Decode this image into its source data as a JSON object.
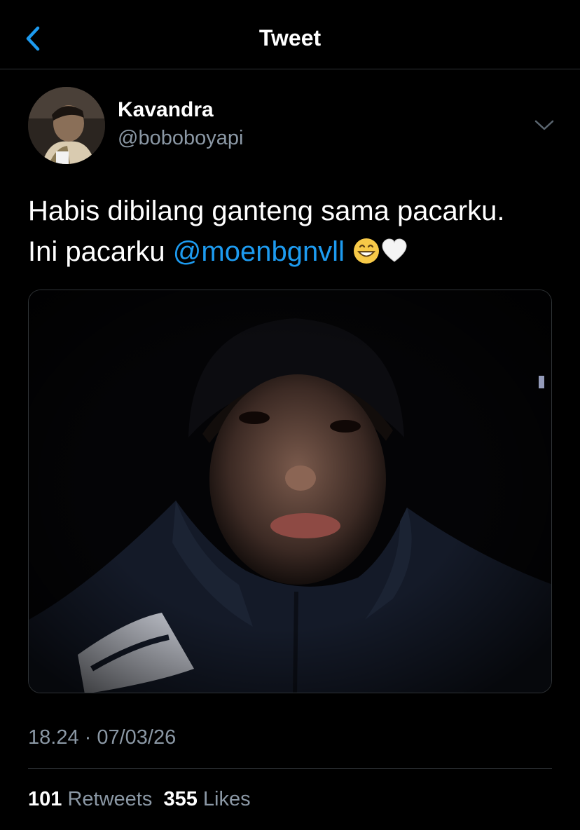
{
  "header": {
    "title": "Tweet",
    "back_icon": "chevron-left-icon",
    "accent": "#1d9bf0"
  },
  "tweet": {
    "author": {
      "name": "Kavandra",
      "handle": "@boboboyapi"
    },
    "menu_icon": "chevron-down-icon",
    "text_line1": "Habis dibilang ganteng sama pacarku.",
    "text_line2_prefix": "Ini pacarku ",
    "mention": "@moenbgnvll",
    "emojis": [
      "grinning-face-icon",
      "white-heart-icon"
    ],
    "timestamp": "18.24 · 07/03/26",
    "retweets_count": "101",
    "retweets_label": "Retweets",
    "likes_count": "355",
    "likes_label": "Likes"
  },
  "colors": {
    "background": "#000000",
    "text": "#ffffff",
    "muted": "#8b98a5",
    "link": "#1d9bf0",
    "border": "#2f3336"
  }
}
